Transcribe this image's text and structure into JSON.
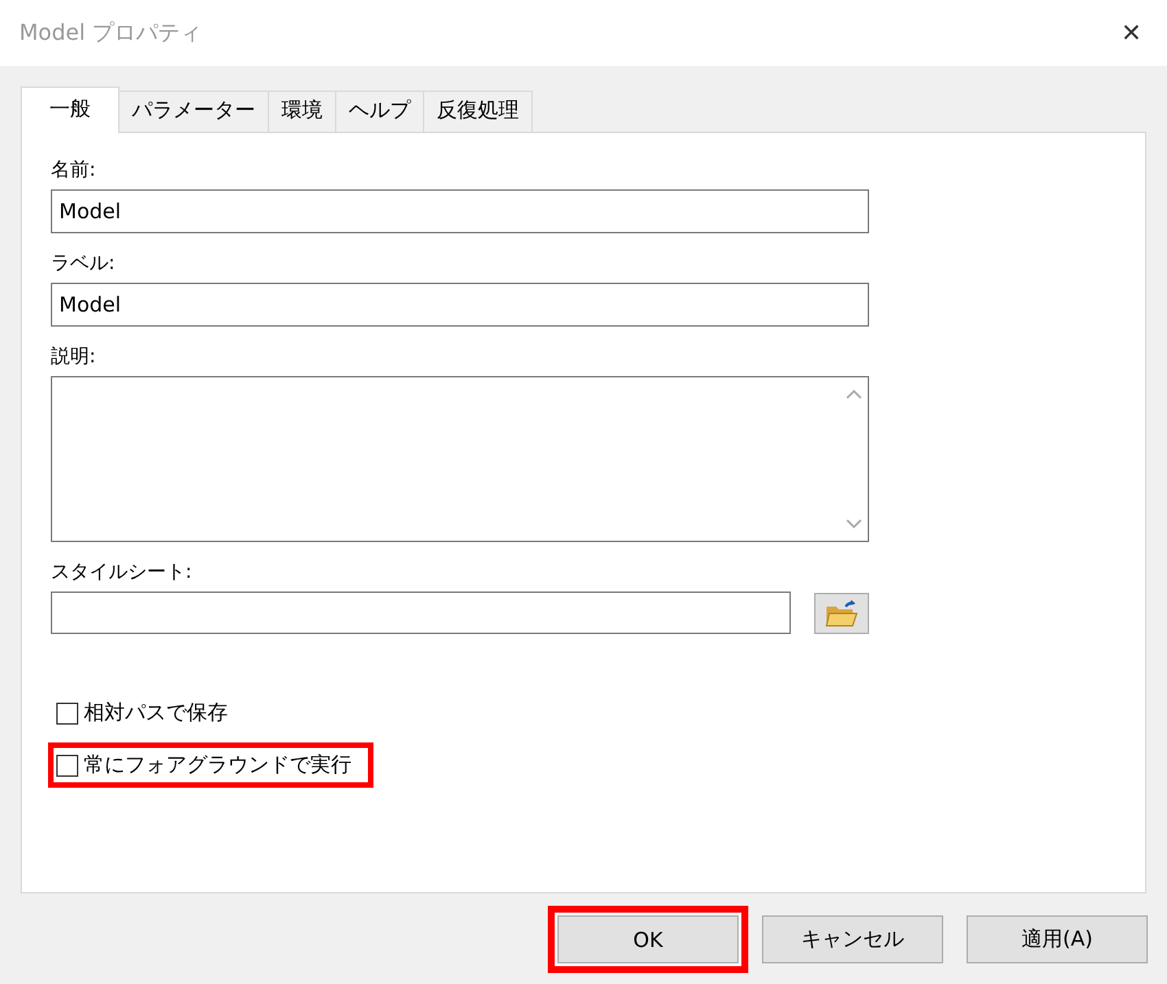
{
  "window": {
    "title": "Model プロパティ",
    "close": "✕"
  },
  "tabs": [
    {
      "label": "一般",
      "selected": true
    },
    {
      "label": "パラメーター",
      "selected": false
    },
    {
      "label": "環境",
      "selected": false
    },
    {
      "label": "ヘルプ",
      "selected": false
    },
    {
      "label": "反復処理",
      "selected": false
    }
  ],
  "fields": [
    {
      "kind": "text",
      "label": "名前:",
      "value": "Model"
    },
    {
      "kind": "text",
      "label": "ラベル:",
      "value": "Model"
    },
    {
      "kind": "textarea",
      "label": "説明:"
    },
    {
      "kind": "file",
      "label": "スタイルシート:"
    }
  ],
  "checkboxes": [
    {
      "label": "相対パスで保存",
      "checked": false,
      "highlighted": false
    },
    {
      "label": "常にフォアグラウンドで実行",
      "checked": false,
      "highlighted": true
    }
  ],
  "buttons": [
    {
      "label": "OK",
      "highlighted": true
    },
    {
      "label": "キャンセル",
      "highlighted": false
    },
    {
      "label": "適用(A)",
      "highlighted": false
    }
  ]
}
